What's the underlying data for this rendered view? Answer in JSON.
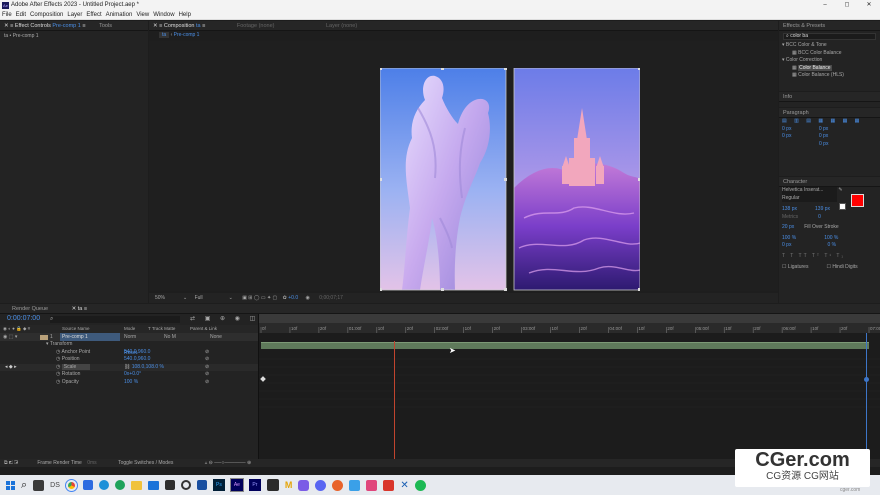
{
  "app": {
    "title": "Adobe After Effects 2023 - Untitled Project.aep *"
  },
  "menu": [
    "File",
    "Edit",
    "Composition",
    "Layer",
    "Effect",
    "Animation",
    "View",
    "Window",
    "Help"
  ],
  "window_controls": [
    "–",
    "◻",
    "✕"
  ],
  "effect_controls": {
    "tab_label": "Effect Controls",
    "tab_target": "Pre-comp 1",
    "tools_tab": "Tools",
    "breadcrumb": "ta • Pre-comp 1"
  },
  "composition": {
    "tab_label": "Composition",
    "tab_target": "ta",
    "footage_tab": "Footage (none)",
    "layer_tab": "Layer (none)",
    "subtab": "ta",
    "subtab2": "Pre-comp 1",
    "zoom": "50%",
    "resolution": "Full",
    "exposure": "+0.0",
    "timecode": "0;00;07;17"
  },
  "effects_presets": {
    "title": "Effects & Presets",
    "search": "color ba",
    "items": [
      {
        "text": "BCC Color & Tone",
        "kind": "folder"
      },
      {
        "text": "BCC Color Balance",
        "kind": "effect"
      },
      {
        "text": "Color Correction",
        "kind": "folder"
      },
      {
        "text": "Color Balance",
        "kind": "effect",
        "selected": true
      },
      {
        "text": "Color Balance (HLS)",
        "kind": "effect"
      }
    ]
  },
  "info": {
    "title": "Info"
  },
  "paragraph": {
    "title": "Paragraph",
    "values": [
      "0 px",
      "0 px",
      "0 px",
      "0 px",
      "0 px"
    ]
  },
  "character": {
    "title": "Character",
    "font": "Helvetica Inserat...",
    "style": "Regular",
    "size": "138 px",
    "leading": "139 px",
    "kerning": "Metrics",
    "tracking": "0",
    "stroke_width": "20 px",
    "stroke_mode": "Fill Over Stroke",
    "vscale": "100 %",
    "hscale": "100 %",
    "baseline": "0 px",
    "tsume": "0 %",
    "ligatures": "Ligatures",
    "hindi": "Hindi Digits",
    "fill_color": "#ff0000"
  },
  "timeline": {
    "render_queue_tab": "Render Queue",
    "comp_tab": "ta",
    "timecode": "0:00:07:00",
    "col_source": "Source Name",
    "col_mode": "Mode",
    "col_trkmat": "T  Track Matte",
    "col_parent": "Parent & Link",
    "layer": {
      "num": "1",
      "name": "Pre-comp 1",
      "mode": "Norm",
      "trkmat": "No M",
      "parent": "None"
    },
    "transform": {
      "label": "Transform",
      "reset": "Reset"
    },
    "props": [
      {
        "name": "Anchor Point",
        "value": "540.0,960.0"
      },
      {
        "name": "Position",
        "value": "540.0,960.0"
      },
      {
        "name": "Scale",
        "value": "108.0,108.0 %"
      },
      {
        "name": "Rotation",
        "value": "0x+0.0°"
      },
      {
        "name": "Opacity",
        "value": "100 %"
      }
    ],
    "ruler": [
      "0f",
      "10f",
      "20f",
      "01:00f",
      "10f",
      "20f",
      "02:00f",
      "10f",
      "20f",
      "03:00f",
      "10f",
      "20f",
      "04:00f",
      "10f",
      "20f",
      "05:00f",
      "10f",
      "20f",
      "06:00f",
      "10f",
      "20f",
      "07:00f"
    ],
    "footer_left": "Frame Render Time",
    "footer_left_val": "0ms",
    "footer_mid": "Toggle Switches / Modes"
  },
  "watermark": {
    "main": "CGer.com",
    "sub": "CG资源 CG网站",
    "small": "cger.com"
  }
}
